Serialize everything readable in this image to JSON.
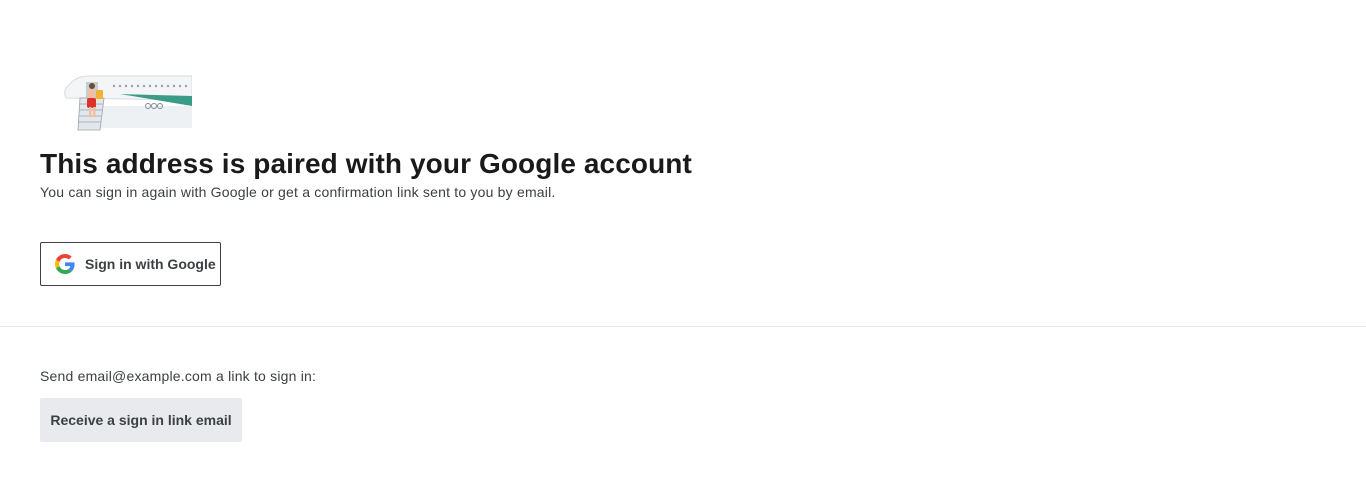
{
  "header": {
    "illustration_icon": "airplane-boarding-illustration",
    "title": "This address is paired with your Google account",
    "subtitle": "You can sign in again with Google or get a confirmation link sent to you by email."
  },
  "google_signin": {
    "icon": "google-g-icon",
    "label": "Sign in with Google"
  },
  "email_link": {
    "prompt": "Send email@example.com a link to sign in:",
    "button_label": "Receive a sign in link email"
  },
  "colors": {
    "text_primary": "#1a1a1a",
    "text_secondary": "#3c4043",
    "divider": "#e6e8eb",
    "secondary_button_bg": "#e8eaed",
    "plane_accent": "#3a9b87",
    "google_blue": "#4285F4",
    "google_red": "#EA4335",
    "google_yellow": "#FBBC05",
    "google_green": "#34A853"
  }
}
